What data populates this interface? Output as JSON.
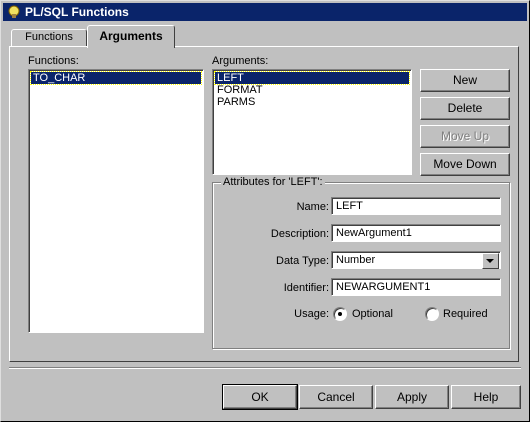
{
  "window": {
    "title": "PL/SQL Functions"
  },
  "tabs": [
    {
      "label": "Functions"
    },
    {
      "label": "Arguments"
    }
  ],
  "functions": {
    "label": "Functions:",
    "items": [
      "TO_CHAR"
    ]
  },
  "arguments": {
    "label": "Arguments:",
    "items": [
      "LEFT",
      "FORMAT",
      "PARMS"
    ]
  },
  "buttons": {
    "new": "New",
    "delete": "Delete",
    "move_up": "Move Up",
    "move_down": "Move Down"
  },
  "attributes": {
    "title": "Attributes for 'LEFT':",
    "name_label": "Name:",
    "name_value": "LEFT",
    "description_label": "Description:",
    "description_value": "NewArgument1",
    "datatype_label": "Data Type:",
    "datatype_value": "Number",
    "identifier_label": "Identifier:",
    "identifier_value": "NEWARGUMENT1",
    "usage_label": "Usage:",
    "optional_label": "Optional",
    "required_label": "Required"
  },
  "footer": {
    "ok": "OK",
    "cancel": "Cancel",
    "apply": "Apply",
    "help": "Help"
  }
}
